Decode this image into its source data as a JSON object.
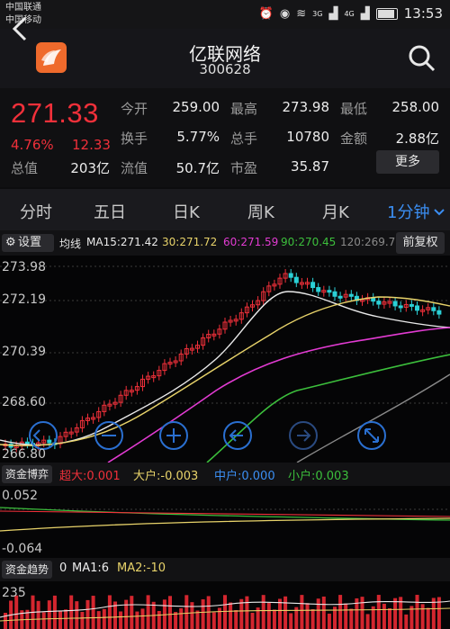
{
  "status_bar": {
    "carrier1": "中国联通",
    "carrier2": "中国移动",
    "time": "13:53",
    "network1": "3G",
    "network2": "4G"
  },
  "header": {
    "title": "亿联网络",
    "code": "300628",
    "back_icon": "back-chevron-icon",
    "search_icon": "search-icon"
  },
  "quote": {
    "price": "271.33",
    "change_pct": "4.76%",
    "change": "12.33",
    "rows": [
      [
        {
          "label": "今开",
          "value": "259.00",
          "color": "white"
        },
        {
          "label": "最高",
          "value": "273.98",
          "color": "red"
        },
        {
          "label": "最低",
          "value": "258.00",
          "color": "green"
        }
      ],
      [
        {
          "label": "换手",
          "value": "5.77%",
          "color": "white"
        },
        {
          "label": "总手",
          "value": "10780",
          "color": "white"
        },
        {
          "label": "金额",
          "value": "2.88亿",
          "color": "white"
        }
      ],
      [
        {
          "label": "流值",
          "value": "50.7亿",
          "color": "white"
        },
        {
          "label": "市盈",
          "value": "35.87",
          "color": "white"
        }
      ]
    ],
    "total_value_label": "总值",
    "total_value": "203亿",
    "more_label": "更多"
  },
  "tabs": {
    "items": [
      "分时",
      "五日",
      "日K",
      "周K",
      "月K",
      "1分钟"
    ],
    "active_index": 5
  },
  "chart_toolbar": {
    "settings_label": "设置",
    "ma_title": "均线",
    "ma15": "MA15:271.42",
    "ma30": "30:271.72",
    "ma60": "60:271.59",
    "ma90": "90:270.45",
    "ma120": "120:269.7",
    "adjust_label": "前复权"
  },
  "chart_data": {
    "type": "candlestick",
    "y_ticks": [
      "273.98",
      "272.19",
      "270.39",
      "268.60",
      "266.80"
    ],
    "ylim": [
      266.8,
      273.98
    ],
    "colors": {
      "up": "#f0303a",
      "down": "#2bd0d6",
      "ma15": "#eaeaea",
      "ma30": "#e8d36a",
      "ma60": "#e23bd2",
      "ma90": "#3cbf3c",
      "ma120": "#8a8a8a"
    },
    "controls": [
      "zoom-in-icon",
      "zoom-out-icon",
      "add-icon",
      "left-arrow-icon",
      "right-arrow-icon",
      "expand-icon"
    ]
  },
  "fund_game": {
    "label": "资金博弈",
    "super_large": "超大:0.001",
    "large": "大户:-0.003",
    "medium": "中户:0.000",
    "small": "小户:0.003",
    "y_top": "0.052",
    "y_bottom": "-0.064"
  },
  "fund_trend": {
    "label": "资金趋势",
    "value": "0",
    "ma1": "MA1:6",
    "ma2": "MA2:-10",
    "y_top": "235"
  }
}
